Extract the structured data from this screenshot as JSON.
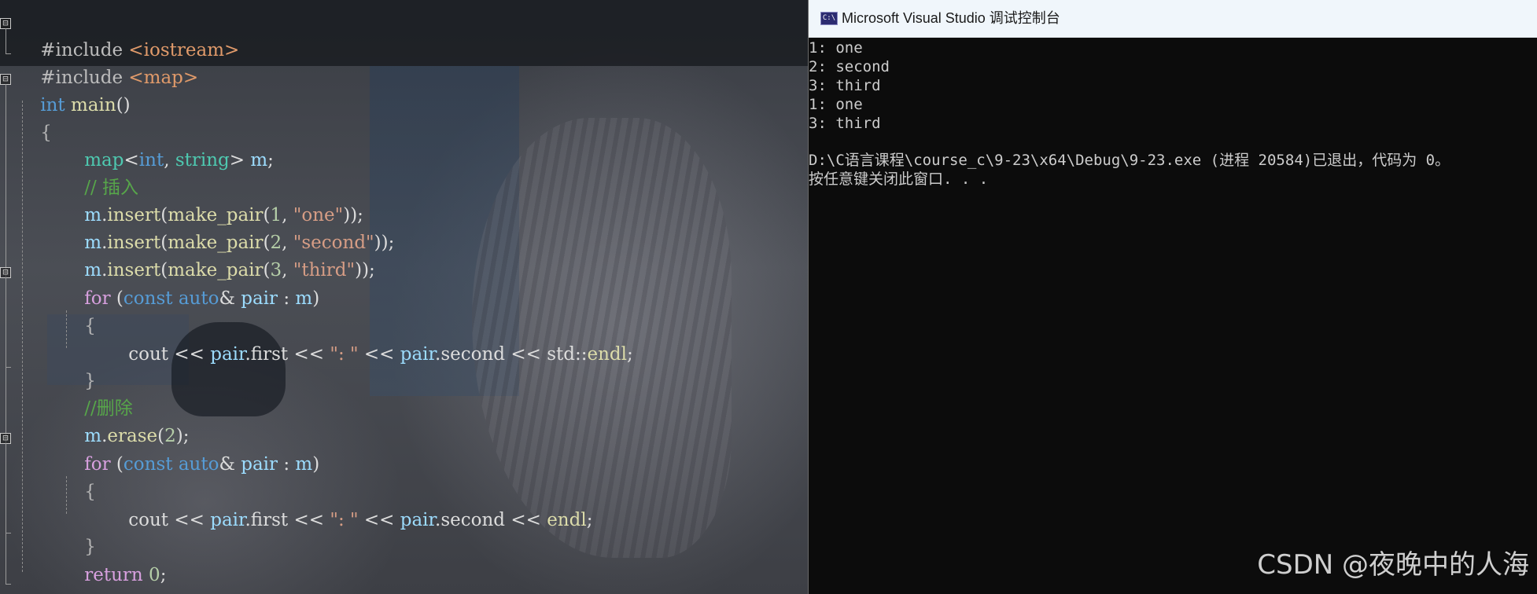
{
  "editor": {
    "theme_colors": {
      "keyword": "#569cd6",
      "control_keyword": "#d8a0df",
      "function": "#dcdcaa",
      "variable": "#9cdcfe",
      "type": "#4ec9b0",
      "string": "#d69d85",
      "number": "#b5cea8",
      "comment": "#57a64a"
    },
    "lines": [
      [
        "#include ",
        "<iostream>"
      ],
      [
        "#include ",
        "<map>"
      ],
      [
        "int",
        " main",
        "()"
      ],
      [
        "{"
      ],
      [
        "map",
        "<",
        "int",
        ", ",
        "string",
        "> ",
        "m",
        ";"
      ],
      [
        "// 插入"
      ],
      [
        "m",
        ".",
        "insert",
        "(",
        "make_pair",
        "(",
        "1",
        ", ",
        "\"one\"",
        "));"
      ],
      [
        "m",
        ".",
        "insert",
        "(",
        "make_pair",
        "(",
        "2",
        ", ",
        "\"second\"",
        "));"
      ],
      [
        "m",
        ".",
        "insert",
        "(",
        "make_pair",
        "(",
        "3",
        ", ",
        "\"third\"",
        "));"
      ],
      [
        "for",
        " (",
        "const",
        " ",
        "auto",
        "& ",
        "pair",
        " : ",
        "m",
        ")"
      ],
      [
        "{"
      ],
      [
        "cout",
        " << ",
        "pair",
        ".",
        "first",
        " << ",
        "\": \"",
        " << ",
        "pair",
        ".",
        "second",
        " << ",
        "std::",
        "endl",
        ";"
      ],
      [
        "}"
      ],
      [
        "//删除"
      ],
      [
        "m",
        ".",
        "erase",
        "(",
        "2",
        ");"
      ],
      [
        "for",
        " (",
        "const",
        " ",
        "auto",
        "& ",
        "pair",
        " : ",
        "m",
        ")"
      ],
      [
        "{"
      ],
      [
        "cout",
        " << ",
        "pair",
        ".",
        "first",
        " << ",
        "\": \"",
        " << ",
        "pair",
        ".",
        "second",
        " << ",
        "endl",
        ";"
      ],
      [
        "}"
      ],
      [
        "return",
        " ",
        "0",
        ";"
      ],
      [
        "}"
      ]
    ],
    "fold_markers": [
      "⊟",
      "⊟",
      "⊟",
      "⊟"
    ]
  },
  "console": {
    "title": "Microsoft Visual Studio 调试控制台",
    "icon": "console-app-icon",
    "icon_text": "C:\\",
    "background": "#0c0c0c",
    "output": [
      "1: one",
      "2: second",
      "3: third",
      "1: one",
      "3: third",
      "",
      "D:\\C语言课程\\course_c\\9-23\\x64\\Debug\\9-23.exe (进程 20584)已退出，代码为 0。",
      "按任意键关闭此窗口. . ."
    ]
  },
  "watermark": "CSDN @夜晚中的人海"
}
